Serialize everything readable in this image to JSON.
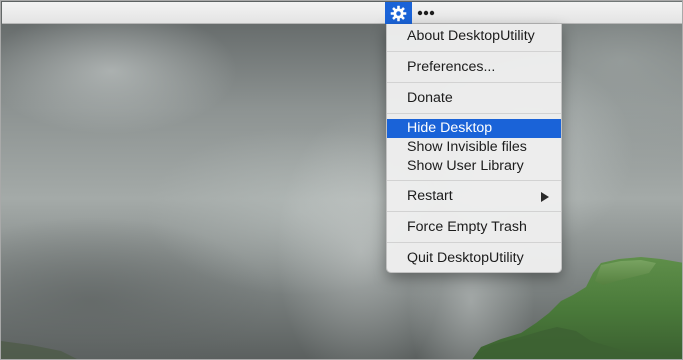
{
  "menubar": {
    "gear_icon": "gear-icon",
    "more_icon": "ellipsis-icon"
  },
  "menu": {
    "about": "About DesktopUtility",
    "preferences": "Preferences...",
    "donate": "Donate",
    "hide_desktop": "Hide Desktop",
    "show_invisible": "Show Invisible files",
    "show_user_library": "Show User Library",
    "restart": "Restart",
    "force_empty_trash": "Force Empty Trash",
    "quit": "Quit DesktopUtility"
  },
  "colors": {
    "accent": "#1a63d8",
    "menu_background": "#eeeeee"
  }
}
